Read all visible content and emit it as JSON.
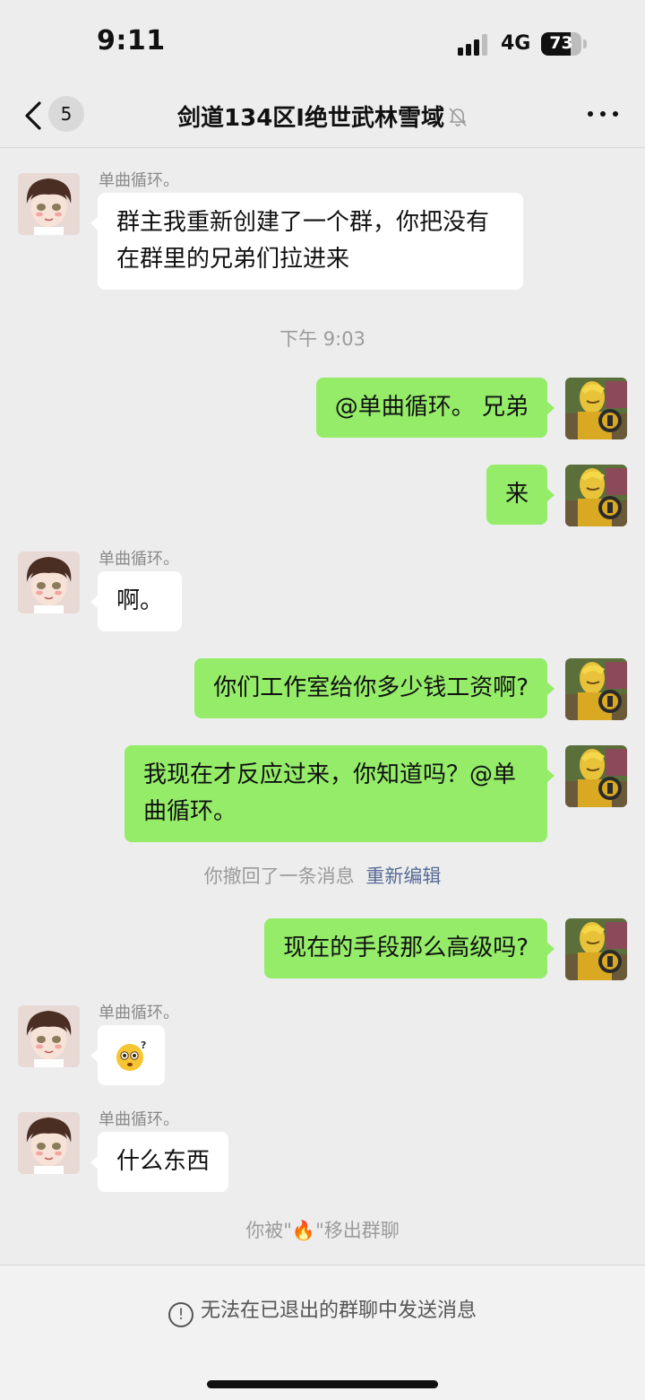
{
  "status": {
    "time": "9:11",
    "network": "4G",
    "battery": "73",
    "battery_level": 0.73
  },
  "nav": {
    "back_count": "5",
    "title": "剑道134区Ⅰ绝世武林雪域"
  },
  "messages": [
    {
      "sender": "单曲循环。",
      "text": "群主我重新创建了一个群，你把没有在群里的兄弟们拉进来"
    },
    {
      "timestamp": "下午 9:03"
    },
    {
      "text": "@单曲循环。 兄弟"
    },
    {
      "text": "来"
    },
    {
      "sender": "单曲循环。",
      "text": "啊。"
    },
    {
      "text": "你们工作室给你多少钱工资啊?"
    },
    {
      "text": "我现在才反应过来，你知道吗？@单曲循环。"
    },
    {
      "recall": "你撤回了一条消息",
      "reedit": "重新编辑"
    },
    {
      "text": "现在的手段那么高级吗?"
    },
    {
      "sender": "单曲循环。",
      "emoji": "🫨"
    },
    {
      "sender": "单曲循环。",
      "text": "什么东西"
    },
    {
      "removed_prefix": "你被\"",
      "removed_emoji": "🔥",
      "removed_suffix": "\"移出群聊"
    }
  ],
  "bottom": {
    "notice": "无法在已退出的群聊中发送消息"
  },
  "colors": {
    "bubble_out": "#95ec69",
    "bubble_in": "#ffffff",
    "link": "#576b95",
    "background": "#ededed"
  }
}
